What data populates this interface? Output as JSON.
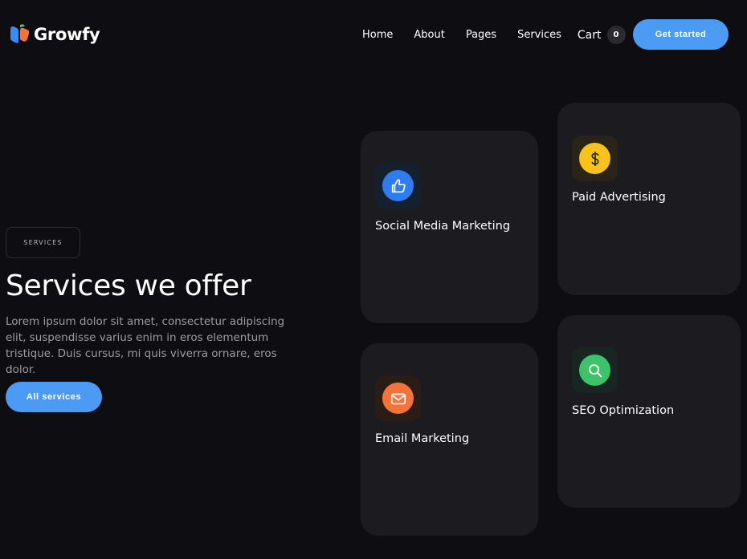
{
  "brand": {
    "name": "Growfy"
  },
  "nav": {
    "links": [
      "Home",
      "About",
      "Pages",
      "Services"
    ],
    "cart_label": "Cart",
    "cart_count": "0",
    "cta_label": "Get started"
  },
  "hero": {
    "tag": "SERVICES",
    "title": "Services we offer",
    "text": "Lorem ipsum dolor sit amet, consectetur adipiscing elit, suspendisse varius enim in eros elementum tristique. Duis cursus, mi quis viverra ornare, eros dolor.",
    "button_label": "All services"
  },
  "services": [
    {
      "title": "Social Media Marketing",
      "icon": "thumbs-up-icon",
      "color": "#2f7bf0"
    },
    {
      "title": "Paid Advertising",
      "icon": "dollar-icon",
      "color": "#f6c21b"
    },
    {
      "title": "Email Marketing",
      "icon": "mail-icon",
      "color": "#f4733b"
    },
    {
      "title": "SEO Optimization",
      "icon": "search-icon",
      "color": "#3ec36b"
    }
  ],
  "colors": {
    "background": "#0d0d12",
    "card": "#1b1b20",
    "accent": "#4b9af4"
  }
}
